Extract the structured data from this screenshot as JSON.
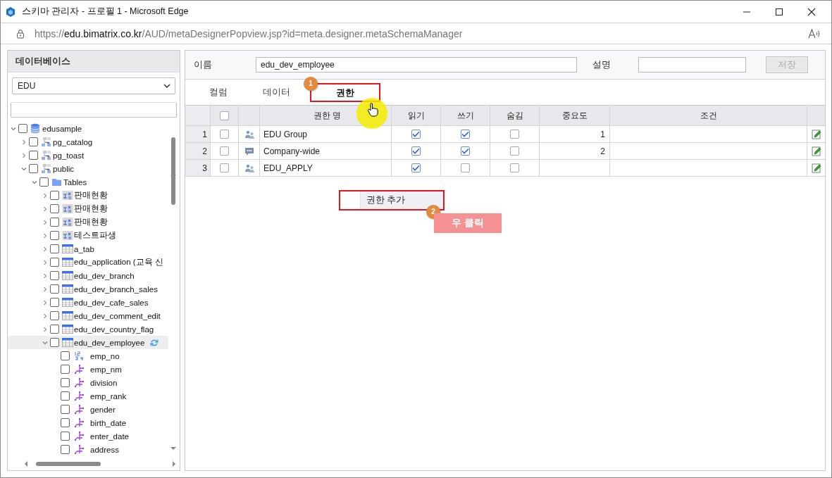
{
  "window": {
    "title": "스키마 관리자 - 프로필 1 - Microsoft Edge"
  },
  "address_bar": {
    "scheme": "https://",
    "domain": "edu.bimatrix.co.kr",
    "path": "/AUD/metaDesignerPopview.jsp?id=meta.designer.metaSchemaManager"
  },
  "sidebar": {
    "title": "데이터베이스",
    "database": "EDU",
    "tree": [
      {
        "label": "edusample",
        "kind": "database",
        "expanded": true,
        "checked": false,
        "selected": false,
        "children": [
          {
            "label": "pg_catalog",
            "kind": "schema",
            "expanded": false,
            "checked": false,
            "selected": false
          },
          {
            "label": "pg_toast",
            "kind": "schema",
            "expanded": false,
            "checked": false,
            "selected": false
          },
          {
            "label": "public",
            "kind": "schema",
            "expanded": true,
            "checked": false,
            "selected": false,
            "children": [
              {
                "label": "Tables",
                "kind": "folder",
                "expanded": true,
                "checked": false,
                "selected": false,
                "children": [
                  {
                    "label": "판매현황",
                    "kind": "view",
                    "expanded": false,
                    "checked": false,
                    "selected": false
                  },
                  {
                    "label": "판매현황",
                    "kind": "view",
                    "expanded": false,
                    "checked": false,
                    "selected": false
                  },
                  {
                    "label": "판매현황",
                    "kind": "view",
                    "expanded": false,
                    "checked": false,
                    "selected": false
                  },
                  {
                    "label": "테스트파생",
                    "kind": "view",
                    "expanded": false,
                    "checked": false,
                    "selected": false
                  },
                  {
                    "label": "a_tab",
                    "kind": "table",
                    "expanded": false,
                    "checked": false,
                    "selected": false
                  },
                  {
                    "label": "edu_application (교육 신",
                    "kind": "table",
                    "expanded": false,
                    "checked": false,
                    "selected": false
                  },
                  {
                    "label": "edu_dev_branch",
                    "kind": "table",
                    "expanded": false,
                    "checked": false,
                    "selected": false
                  },
                  {
                    "label": "edu_dev_branch_sales",
                    "kind": "table",
                    "expanded": false,
                    "checked": false,
                    "selected": false
                  },
                  {
                    "label": "edu_dev_cafe_sales",
                    "kind": "table",
                    "expanded": false,
                    "checked": false,
                    "selected": false
                  },
                  {
                    "label": "edu_dev_comment_edit",
                    "kind": "table",
                    "expanded": false,
                    "checked": false,
                    "selected": false
                  },
                  {
                    "label": "edu_dev_country_flag",
                    "kind": "table",
                    "expanded": false,
                    "checked": false,
                    "selected": false
                  },
                  {
                    "label": "edu_dev_employee",
                    "kind": "table",
                    "expanded": true,
                    "checked": false,
                    "selected": true,
                    "children": [
                      {
                        "label": "emp_no",
                        "kind": "number-column",
                        "checked": false,
                        "selected": false
                      },
                      {
                        "label": "emp_nm",
                        "kind": "text-column",
                        "checked": false,
                        "selected": false
                      },
                      {
                        "label": "division",
                        "kind": "text-column",
                        "checked": false,
                        "selected": false
                      },
                      {
                        "label": "emp_rank",
                        "kind": "text-column",
                        "checked": false,
                        "selected": false
                      },
                      {
                        "label": "gender",
                        "kind": "text-column",
                        "checked": false,
                        "selected": false
                      },
                      {
                        "label": "birth_date",
                        "kind": "text-column",
                        "checked": false,
                        "selected": false
                      },
                      {
                        "label": "enter_date",
                        "kind": "text-column",
                        "checked": false,
                        "selected": false
                      },
                      {
                        "label": "address",
                        "kind": "text-column",
                        "checked": false,
                        "selected": false
                      }
                    ]
                  }
                ]
              }
            ]
          }
        ]
      }
    ]
  },
  "form": {
    "name_label": "이름",
    "name_value": "edu_dev_employee",
    "description_label": "설명",
    "save_button": {
      "label": "저장",
      "disabled": true
    }
  },
  "tabs": [
    {
      "label": "컬럼",
      "selected": false
    },
    {
      "label": "데이터",
      "selected": false
    },
    {
      "label": "권한",
      "selected": true
    }
  ],
  "grid": {
    "all_checked": false,
    "columns": [
      "권한 명",
      "읽기",
      "쓰기",
      "숨김",
      "중요도",
      "조건"
    ],
    "rows": [
      {
        "number": "1",
        "checked": false,
        "kind": "group",
        "name": "EDU Group",
        "read": true,
        "write": true,
        "hidden": false,
        "priority": "1"
      },
      {
        "number": "2",
        "checked": false,
        "kind": "comment",
        "name": "Company-wide",
        "read": true,
        "write": true,
        "hidden": false,
        "priority": "2"
      },
      {
        "number": "3",
        "checked": false,
        "kind": "group",
        "name": "EDU_APPLY",
        "read": true,
        "write": false,
        "hidden": false
      }
    ]
  },
  "context_menu": {
    "items": [
      {
        "label": "권한 추가"
      }
    ]
  },
  "annotations": [
    {
      "kind": "step",
      "number": "1"
    },
    {
      "kind": "step",
      "number": "2"
    },
    {
      "kind": "label",
      "text": "우 클릭"
    }
  ]
}
